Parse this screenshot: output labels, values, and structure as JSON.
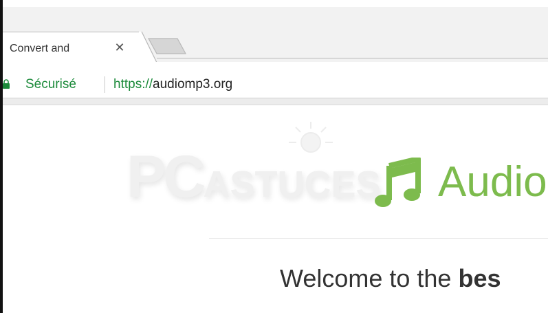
{
  "browser": {
    "tab": {
      "title": "Convert and",
      "close_glyph": "✕"
    },
    "address_bar": {
      "secure_label": "Sécurisé",
      "url_scheme": "https://",
      "url_host": "audiomp3.org"
    }
  },
  "page": {
    "watermark": {
      "pc": "PC",
      "astuces": "ASTUCES"
    },
    "brand": {
      "name": "Audio",
      "icon": "music-note-icon",
      "color": "#7dbb4d"
    },
    "welcome": {
      "prefix": "Welcome to the ",
      "bold": "bes"
    }
  },
  "colors": {
    "secure_green": "#1b8a3a",
    "brand_green": "#7dbb4d"
  }
}
